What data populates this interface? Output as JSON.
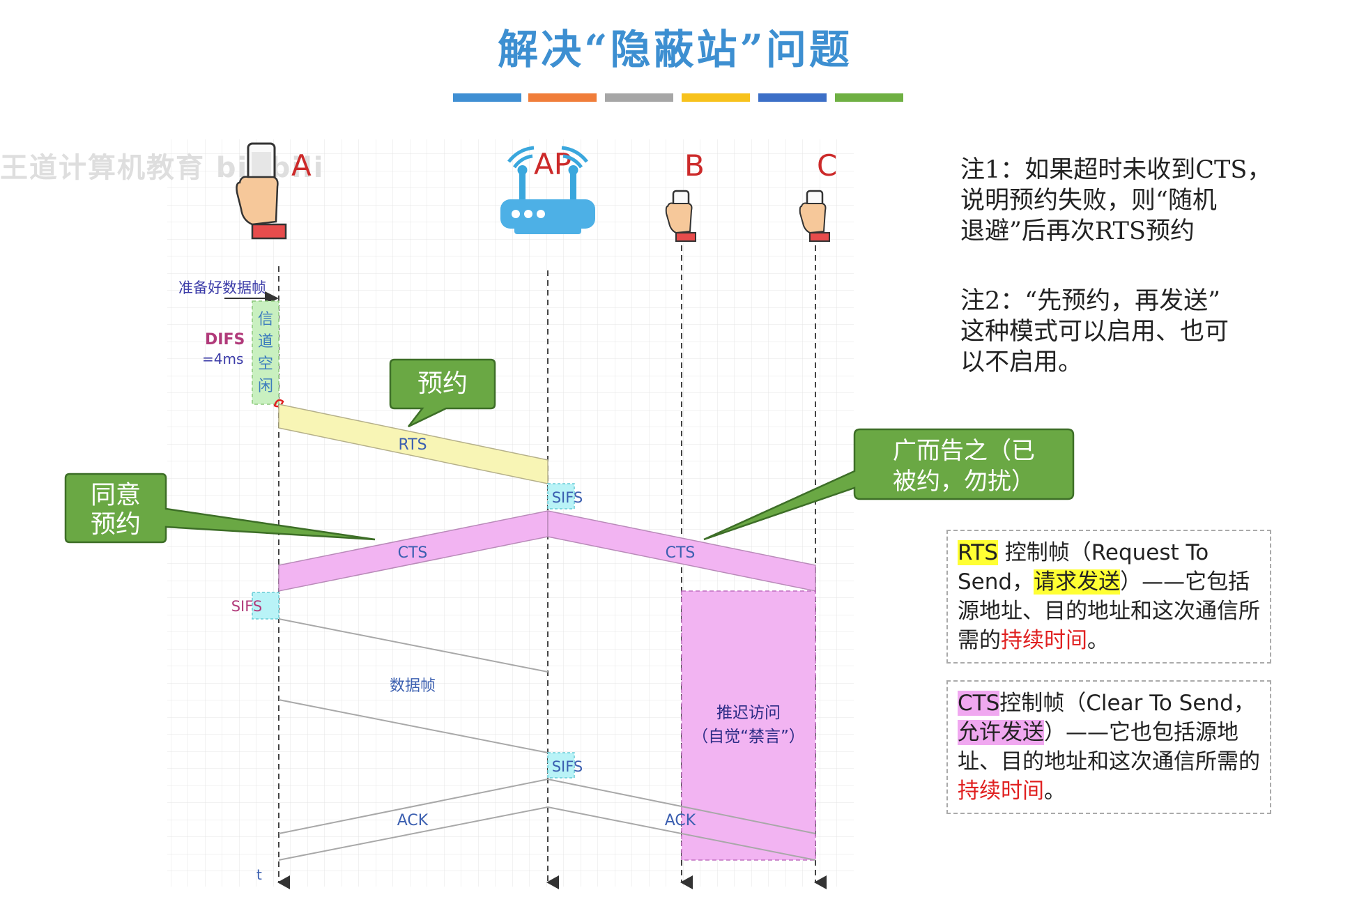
{
  "title": "解决“隐蔽站”问题",
  "watermark": "王道计算机教育 bilibili",
  "colors": {
    "title": "#3d8fd1",
    "bars": [
      "#3f8fd3",
      "#f07d3a",
      "#a6a6a6",
      "#f7c21c",
      "#3c6fc7",
      "#6fb043"
    ],
    "rts": "#f8f5b5",
    "cts": "#f2b4f2",
    "sifs": "#b9f3f7",
    "difs": "#c9f0c0",
    "callout": "#6aa844",
    "nav": "#2c2c86"
  },
  "stations": {
    "a": "A",
    "ap": "AP",
    "b": "B",
    "c": "C"
  },
  "labels": {
    "prepare": "准备好数据帧",
    "difs": "DIFS",
    "difs_value": "=4ms",
    "idle": [
      "信",
      "道",
      "空",
      "闲"
    ],
    "rts": "RTS",
    "cts": "CTS",
    "sifs": "SIFS",
    "data": "数据帧",
    "ack": "ACK",
    "nav_1": "推迟访问",
    "nav_2": "（自觉“禁言”）",
    "t": "t"
  },
  "callouts": {
    "reserve": "预约",
    "agree_1": "同意",
    "agree_2": "预约",
    "broadcast_1": "广而告之（已",
    "broadcast_2": "被约，勿扰）"
  },
  "notes": {
    "note1_1": "注1：如果超时未收到CTS，",
    "note1_2": "说明预约失败，则“随机",
    "note1_3": "退避”后再次RTS预约",
    "note2_1": "注2：“先预约，再发送”",
    "note2_2": "这种模式可以启用、也可",
    "note2_3": "以不启用。"
  },
  "rts_def": {
    "abbr": "RTS",
    "part1": " 控制帧（Request To Send，",
    "hl": "请求发送",
    "part2": "）——它包括源地址、目的地址和这次通信所需的",
    "red": "持续时间",
    "end": "。"
  },
  "cts_def": {
    "abbr": "CTS",
    "part1": "控制帧（Clear To Send，",
    "hl": "允许发送",
    "part2": "）——它也包括源地址、目的地址和这次通信所需的",
    "red": "持续时间",
    "end": "。"
  }
}
